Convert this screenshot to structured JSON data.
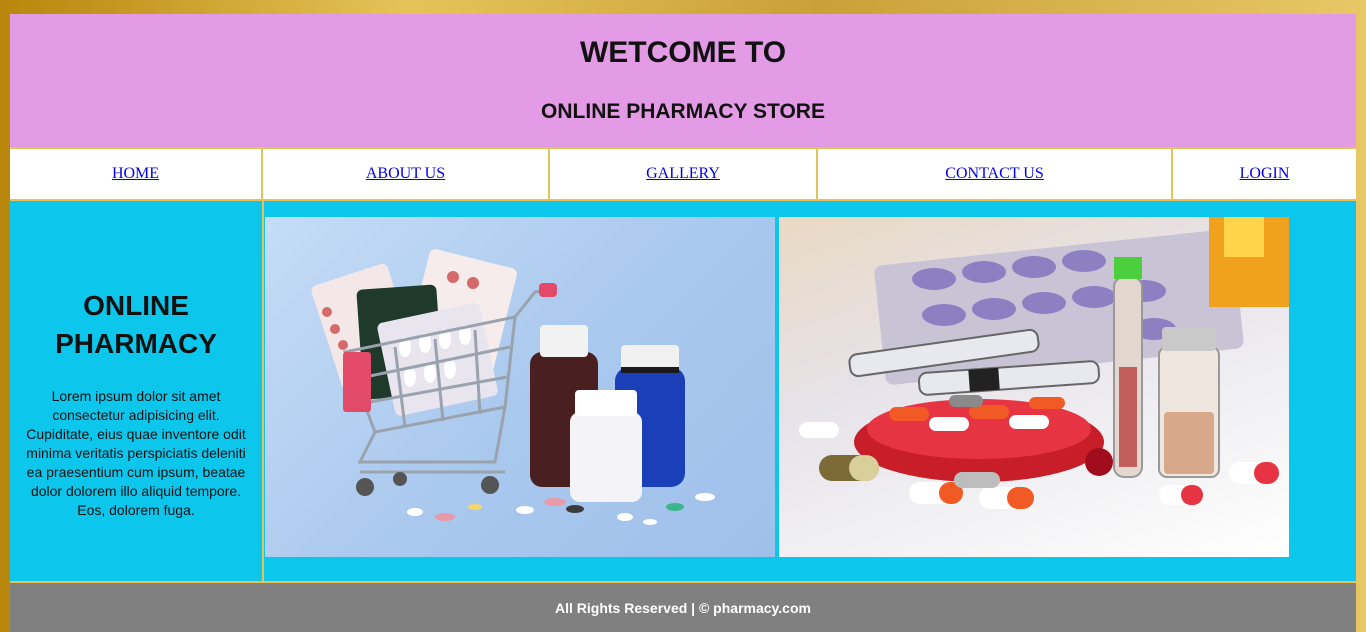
{
  "header": {
    "title": "WETCOME TO",
    "subtitle": "ONLINE PHARMACY STORE"
  },
  "nav": {
    "items": [
      {
        "label": "HOME"
      },
      {
        "label": "ABOUT US"
      },
      {
        "label": "GALLERY"
      },
      {
        "label": "CONTACT US"
      },
      {
        "label": "LOGIN"
      }
    ]
  },
  "sidebar": {
    "title": "ONLINE PHARMACY",
    "text": "Lorem ipsum dolor sit amet consectetur adipisicing elit. Cupiditate, eius quae inventore odit minima veritatis perspiciatis deleniti ea praesentium cum ipsum, beatae dolor dolorem illo aliquid tempore. Eos, dolorem fuga."
  },
  "gallery": {
    "images": [
      {
        "icon": "shopping-cart-medicine-photo"
      },
      {
        "icon": "pills-syringe-vials-photo"
      }
    ]
  },
  "footer": {
    "text": "All Rights Reserved | © pharmacy.com"
  },
  "colors": {
    "header_bg": "#e49be6",
    "content_bg": "#0cc6ec",
    "footer_bg": "#808080",
    "border_gold": "#e6c35a",
    "link": "#0000ee"
  }
}
